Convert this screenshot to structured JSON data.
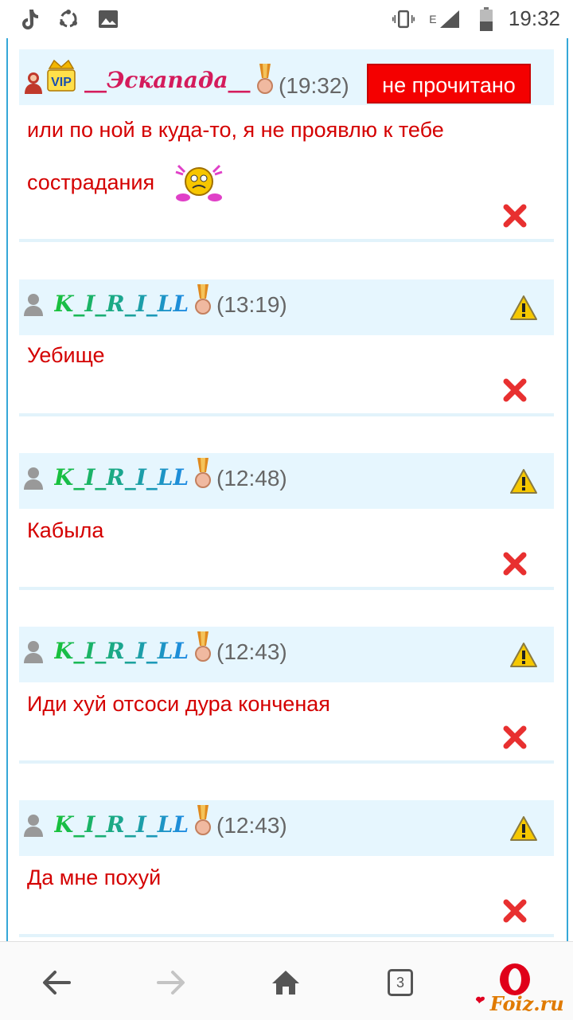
{
  "status_bar": {
    "time": "19:32",
    "network": "E",
    "icons_left": [
      "tiktok-icon",
      "sync-icon",
      "image-icon"
    ],
    "icons_right": [
      "vibrate-icon",
      "signal-icon",
      "battery-icon"
    ]
  },
  "messages": [
    {
      "nick": "__Эскапада__",
      "nick_color": "#d41c5c",
      "time": "(19:32)",
      "badge": "не прочитано",
      "text_line1": "или по ной в куда-то, я не проявлю к тебе",
      "text_line2": "сострадания",
      "avatar": "female-avatar-icon",
      "vip": "VIP"
    },
    {
      "nick": "K_I_R_I_LL",
      "time": "(13:19)",
      "text": "Уебище"
    },
    {
      "nick": "K_I_R_I_LL",
      "time": "(12:48)",
      "text": "Кабыла"
    },
    {
      "nick": "K_I_R_I_LL",
      "time": "(12:43)",
      "text": "Иди хуй отсоси дура конченая"
    },
    {
      "nick": "K_I_R_I_LL",
      "time": "(12:43)",
      "text": "Да мне похуй"
    }
  ],
  "browser_bar": {
    "tabs_count": "3",
    "watermark": "Foiz.ru"
  },
  "colors": {
    "frame_border": "#35a7d8",
    "header_bg": "#e6f6fe",
    "message_text": "#d40000",
    "unread_bg": "#f40000"
  }
}
